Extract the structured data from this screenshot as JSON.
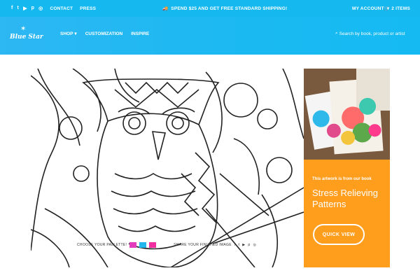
{
  "topbar": {
    "social_icons": [
      "facebook-icon",
      "twitter-icon",
      "youtube-icon",
      "pinterest-icon",
      "instagram-icon"
    ],
    "contact_label": "CONTACT",
    "press_label": "PRESS",
    "promo_text": "SPEND $25 AND GET FREE STANDARD SHIPPING!",
    "account_label": "MY ACCOUNT",
    "cart_label": "2 ITEMS"
  },
  "header": {
    "logo_text": "Blue Star",
    "nav": [
      {
        "label": "SHOP"
      },
      {
        "label": "CUSTOMIZATION"
      },
      {
        "label": "INSPIRE"
      }
    ],
    "search_placeholder": "Search by book, product or artist"
  },
  "coloring": {
    "palette_label": "CHOOSE YOUR PALLETTE!",
    "share_label": "SHARE YOUR FINISHED IMAGE",
    "palette_colors": [
      "#e23cbc",
      "#22b8ee",
      "#f12fa0"
    ]
  },
  "promo": {
    "kicker": "This artwork is from our book",
    "title": "Stress Relieving Patterns",
    "button_label": "QUICK VIEW"
  },
  "colors": {
    "accent_blue": "#16b8f0",
    "promo_orange": "#ff9d1d"
  }
}
